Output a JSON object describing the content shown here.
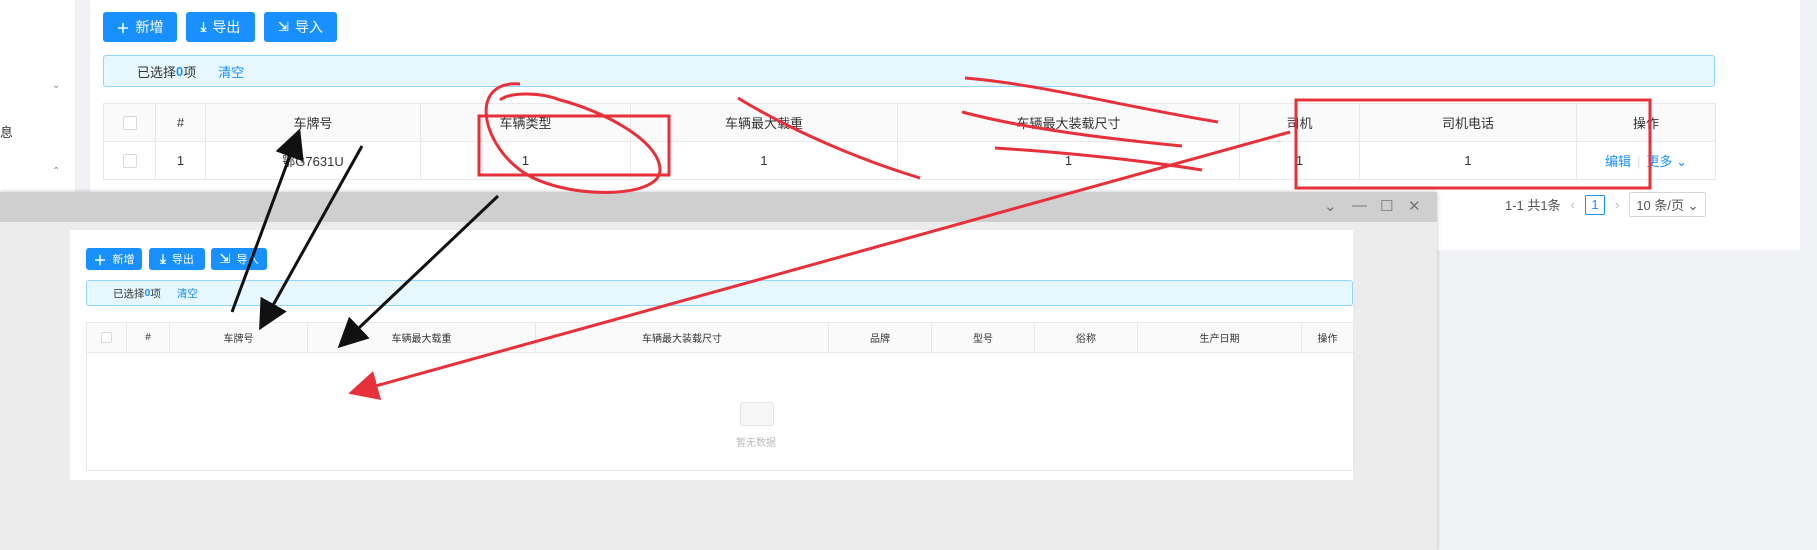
{
  "sidebar": {
    "fragment_text": "息"
  },
  "main": {
    "buttons": {
      "add": "新增",
      "export": "导出",
      "import": "导入"
    },
    "selection": {
      "prefix": "已选择 ",
      "count": "0",
      "suffix": "项",
      "clear": "清空"
    },
    "table": {
      "headers": [
        "#",
        "车牌号",
        "车辆类型",
        "车辆最大载重",
        "车辆最大装载尺寸",
        "司机",
        "司机电话",
        "操作"
      ],
      "row": {
        "index": "1",
        "plate": "鄂G7631U",
        "vehicle_type": "1",
        "max_load": "1",
        "max_size": "1",
        "driver": "1",
        "driver_phone": "1"
      },
      "actions": {
        "edit": "编辑",
        "more": "更多"
      }
    },
    "pagination": {
      "summary": "1-1 共1条",
      "page": "1",
      "size": "10 条/页"
    }
  },
  "window": {
    "buttons": {
      "add": "新增",
      "export": "导出",
      "import": "导入"
    },
    "selection": {
      "prefix": "已选择 ",
      "count": "0",
      "suffix": "项",
      "clear": "清空"
    },
    "table": {
      "headers": [
        "#",
        "车牌号",
        "车辆最大载重",
        "车辆最大装载尺寸",
        "品牌",
        "型号",
        "俗称",
        "生产日期",
        "操作"
      ]
    },
    "empty_text": "暂无数据"
  },
  "colors": {
    "accent": "#1890ff",
    "annotation_red": "#e8303a",
    "annotation_black": "#111111"
  }
}
